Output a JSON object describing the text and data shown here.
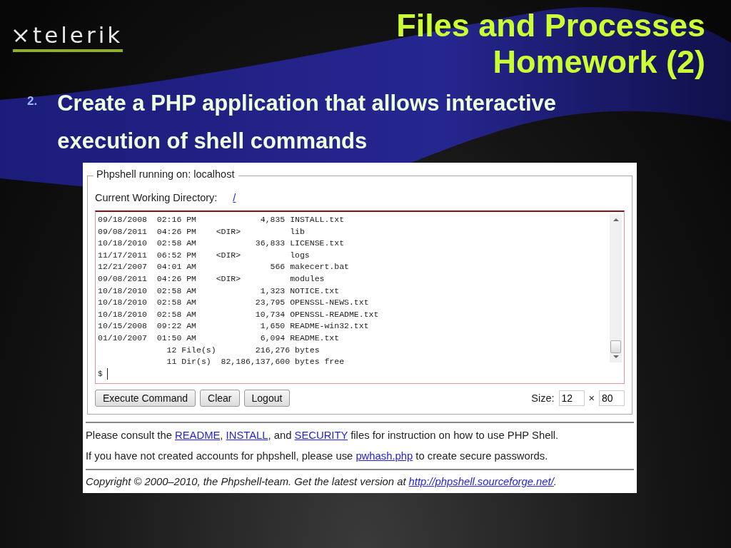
{
  "logo": {
    "text": "telerik"
  },
  "title": {
    "lines": [
      "Files and Processes",
      "Homework (2)"
    ]
  },
  "bullet": {
    "number": "2.",
    "text": "Create a PHP application that allows interactive execution of shell commands"
  },
  "shell": {
    "legend": "Phpshell running on: localhost",
    "cwd_label": "Current Working Directory:",
    "cwd_link": "/",
    "output_lines": [
      "09/18/2008  02:16 PM             4,835 INSTALL.txt",
      "09/08/2011  04:26 PM    <DIR>          lib",
      "10/18/2010  02:58 AM            36,833 LICENSE.txt",
      "11/17/2011  06:52 PM    <DIR>          logs",
      "12/21/2007  04:01 AM               566 makecert.bat",
      "09/08/2011  04:26 PM    <DIR>          modules",
      "10/18/2010  02:58 AM             1,323 NOTICE.txt",
      "10/18/2010  02:58 AM            23,795 OPENSSL-NEWS.txt",
      "10/18/2010  02:58 AM            10,734 OPENSSL-README.txt",
      "10/15/2008  09:22 AM             1,650 README-win32.txt",
      "01/10/2007  01:50 AM             6,094 README.txt",
      "              12 File(s)        216,276 bytes",
      "              11 Dir(s)  82,186,137,600 bytes free"
    ],
    "prompt": "$",
    "buttons": [
      "Execute Command",
      "Clear",
      "Logout"
    ],
    "size_label": "Size:",
    "rows": "12",
    "times": "×",
    "cols": "80"
  },
  "footer": {
    "paragraphs": [
      [
        {
          "kind": "text",
          "text": "Please consult the "
        },
        {
          "kind": "link",
          "text": "README"
        },
        {
          "kind": "text",
          "text": ", "
        },
        {
          "kind": "link",
          "text": "INSTALL"
        },
        {
          "kind": "text",
          "text": ", and "
        },
        {
          "kind": "link",
          "text": "SECURITY"
        },
        {
          "kind": "text",
          "text": " files for instruction on how to use PHP Shell."
        }
      ],
      [
        {
          "kind": "text",
          "text": "If you have not created accounts for phpshell, please use "
        },
        {
          "kind": "link",
          "text": "pwhash.php"
        },
        {
          "kind": "text",
          "text": " to create secure passwords."
        }
      ]
    ],
    "copyright": [
      {
        "kind": "text",
        "text": "Copyright © 2000–2010, the Phpshell-team. Get the latest version at "
      },
      {
        "kind": "link",
        "text": "http://phpshell.sourceforge.net/"
      },
      {
        "kind": "text",
        "text": "."
      }
    ]
  }
}
